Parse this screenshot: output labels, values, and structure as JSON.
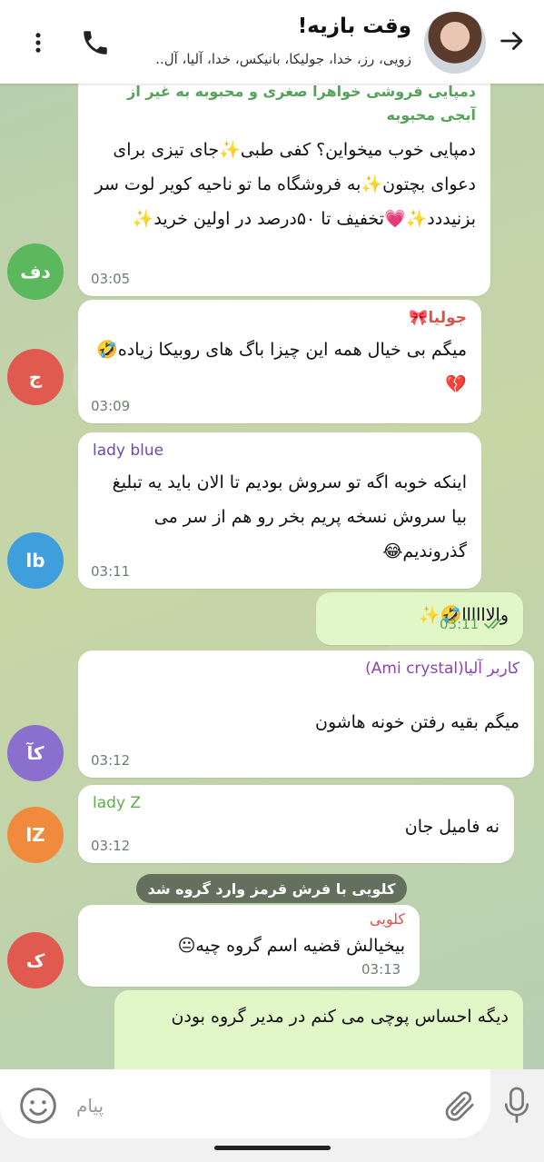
{
  "header": {
    "title": "وقت بازیه!",
    "subtitle": "زویی، رز، خدا، جولیکا، بانیکس، خدا، آلیا، آل..",
    "back_icon": "arrow-right-icon",
    "call_icon": "phone-icon",
    "menu_icon": "vertical-dots-icon"
  },
  "messages": [
    {
      "sender": "دمپایی فروشی خواهرا صغری و محبوبه به غیر از آبجی محبوبه",
      "text": "دمپایی خوب میخواین؟ کفی طبی✨جای تیزی برای دعوای بچتون✨به فروشگاه ما تو ناحیه کویر لوت سر بزنیددد✨💗تخفیف تا ۵۰درصد در اولین خرید✨",
      "time": "03:05",
      "avatar": "دف",
      "avatar_color": "#5cb85c",
      "sender_color": "#55a35a"
    },
    {
      "sender": "جولیا🎀",
      "text": "میگم بی خیال همه این چیزا باگ های روبیکا زیاده🤣💔",
      "time": "03:09",
      "avatar": "ج",
      "avatar_color": "#e05a4f",
      "sender_color": "#d9534f"
    },
    {
      "sender": "lady blue",
      "text": "اینکه خوبه اگه تو سروش بودیم تا الان باید یه تبلیغ بیا سروش نسخه پریم بخر رو هم از سر می گذروندیم😂",
      "time": "03:11",
      "avatar": "lb",
      "avatar_color": "#3f9fdc",
      "sender_color": "#6a4aa8"
    },
    {
      "text": "والاااااا🤣✨",
      "time": "03:11",
      "outgoing": true
    },
    {
      "sender": "کاربر آلیا(Ami crystal)",
      "text": "میگم بقیه رفتن خونه هاشون",
      "time": "03:12",
      "avatar": "کآ",
      "avatar_color": "#8b6fcf",
      "sender_color": "#8e44ad"
    },
    {
      "sender": "lady Z",
      "text": "نه فامیل جان",
      "time": "03:12",
      "avatar": "lZ",
      "avatar_color": "#f08a3c",
      "sender_color": "#5cae4a"
    },
    {
      "sender": "کلویی",
      "text": "بیخیالش قضیه اسم گروه چیه😐",
      "time": "03:13",
      "avatar": "ک",
      "avatar_color": "#e05a4f",
      "sender_color": "#d9534f"
    },
    {
      "text": "دیگه احساس پوچی می کنم در مدیر گروه بودن",
      "outgoing": true
    }
  ],
  "service_message": "کلویی با فرش قرمز وارد گروه شد",
  "input": {
    "placeholder": "پیام",
    "emoji_icon": "smiley-icon",
    "attach_icon": "paperclip-icon",
    "mic_icon": "microphone-icon"
  }
}
